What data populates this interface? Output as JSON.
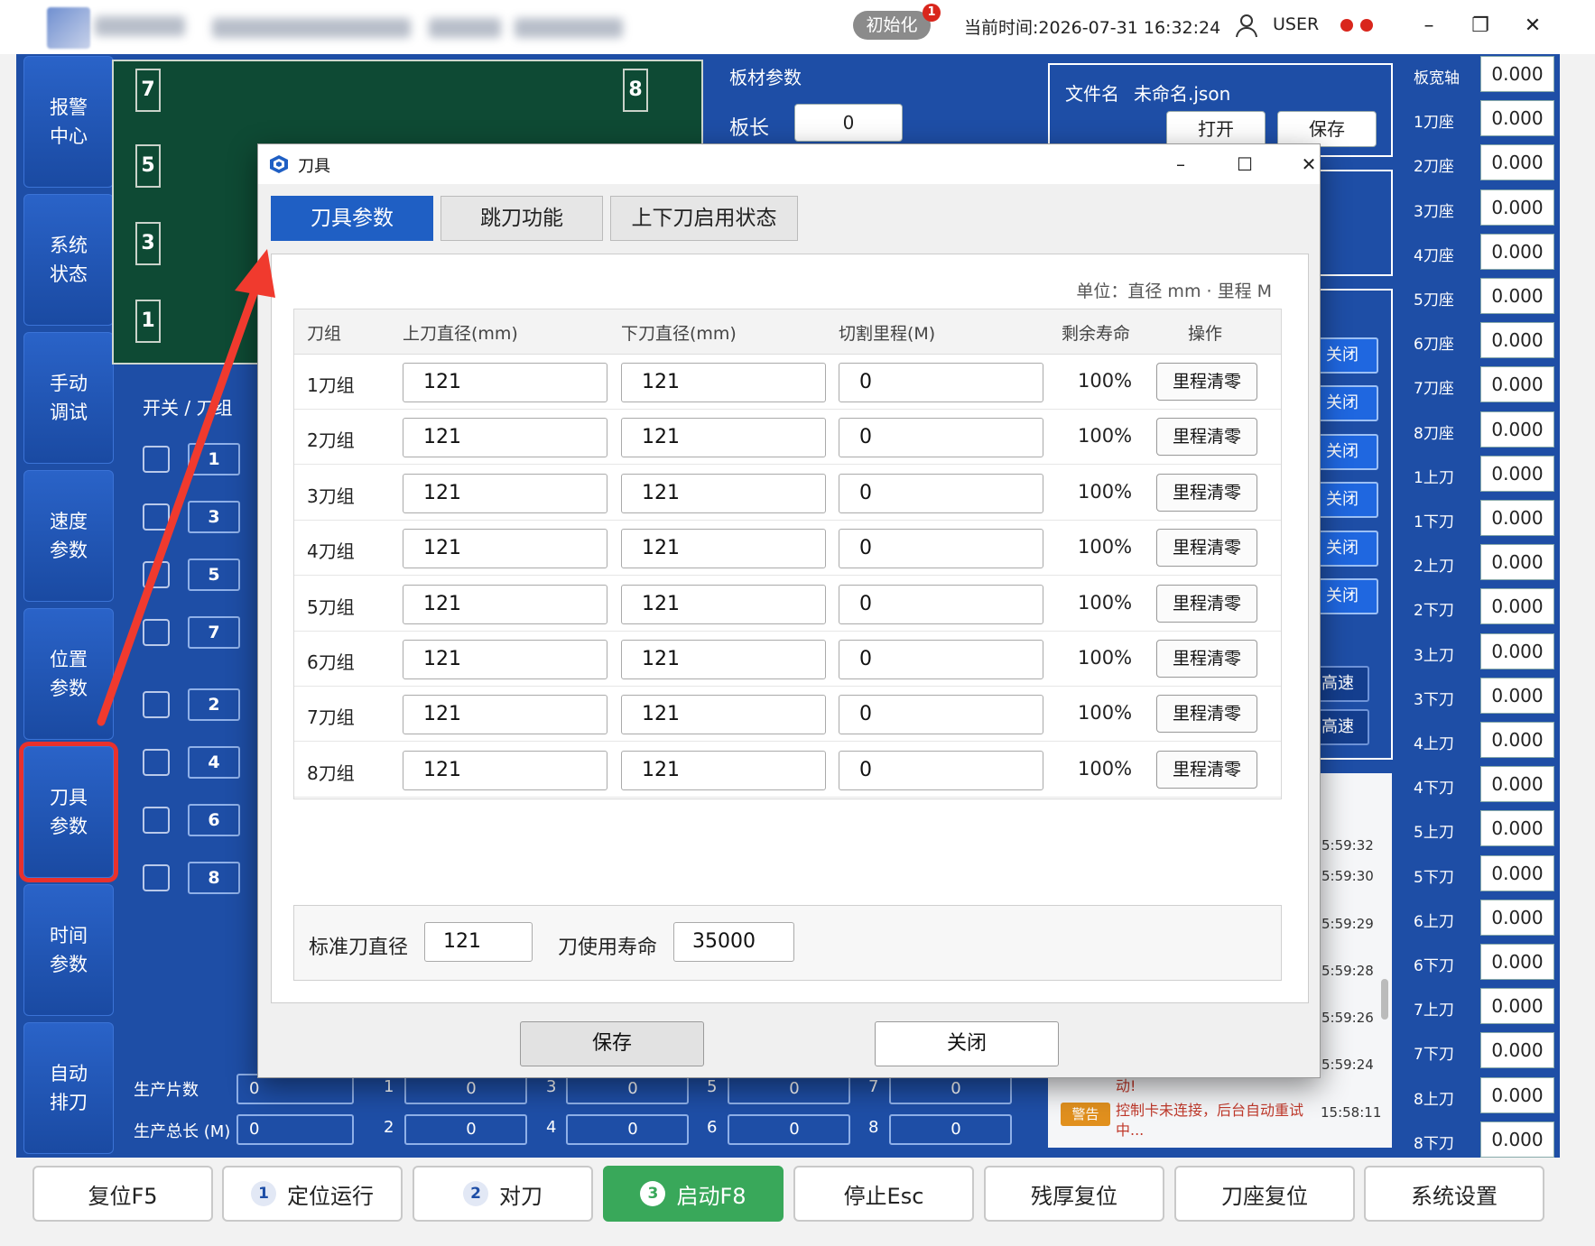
{
  "titlebar": {
    "init_badge": "初始化",
    "notify_count": "1",
    "current_time": "当前时间:2026-07-31 16:32:24",
    "user": "USER",
    "min": "–",
    "max": "❐",
    "close": "✕"
  },
  "nav": [
    {
      "line1": "报警",
      "line2": "中心"
    },
    {
      "line1": "系统",
      "line2": "状态"
    },
    {
      "line1": "手动",
      "line2": "调试"
    },
    {
      "line1": "速度",
      "line2": "参数"
    },
    {
      "line1": "位置",
      "line2": "参数"
    },
    {
      "line1": "刀具",
      "line2": "参数"
    },
    {
      "line1": "时间",
      "line2": "参数"
    },
    {
      "line1": "自动",
      "line2": "排刀"
    }
  ],
  "green_labels": {
    "a": "7",
    "b": "8",
    "c": "5",
    "d": "3",
    "e": "1"
  },
  "switch_label": "开关 / 刀组",
  "knife_nums": [
    "1",
    "3",
    "5",
    "7",
    "2",
    "4",
    "6",
    "8"
  ],
  "board": {
    "title": "板材参数",
    "length_label": "板长",
    "length_value": "0"
  },
  "file": {
    "label": "文件名",
    "name": "未命名.json",
    "open": "打开",
    "save": "保存"
  },
  "close_buttons": [
    "关闭",
    "关闭",
    "关闭",
    "关闭",
    "关闭",
    "关闭"
  ],
  "speed_buttons": [
    "高速",
    "高速"
  ],
  "production": {
    "count_label": "生产片数",
    "total_label": "生产总长 (M)",
    "row1": [
      {
        "n": "",
        "v": "0"
      },
      {
        "n": "1",
        "v": "0"
      },
      {
        "n": "3",
        "v": "0"
      },
      {
        "n": "5",
        "v": "0"
      },
      {
        "n": "7",
        "v": "0"
      }
    ],
    "row2": [
      {
        "n": "",
        "v": "0"
      },
      {
        "n": "2",
        "v": "0"
      },
      {
        "n": "4",
        "v": "0"
      },
      {
        "n": "6",
        "v": "0"
      },
      {
        "n": "8",
        "v": "0"
      }
    ]
  },
  "log": {
    "times": [
      "5:59:32",
      "5:59:30",
      "5:59:29",
      "5:59:28",
      "5:59:26",
      "5:59:24"
    ],
    "partial_text": "动!",
    "entry_tag": "警告",
    "entry_text": "控制卡未连接，后台自动重试中...",
    "entry_time": "15:58:11"
  },
  "axes": [
    {
      "label": "板宽轴",
      "value": "0.000"
    },
    {
      "label": "1刀座",
      "value": "0.000"
    },
    {
      "label": "2刀座",
      "value": "0.000"
    },
    {
      "label": "3刀座",
      "value": "0.000"
    },
    {
      "label": "4刀座",
      "value": "0.000"
    },
    {
      "label": "5刀座",
      "value": "0.000"
    },
    {
      "label": "6刀座",
      "value": "0.000"
    },
    {
      "label": "7刀座",
      "value": "0.000"
    },
    {
      "label": "8刀座",
      "value": "0.000"
    },
    {
      "label": "1上刀",
      "value": "0.000"
    },
    {
      "label": "1下刀",
      "value": "0.000"
    },
    {
      "label": "2上刀",
      "value": "0.000"
    },
    {
      "label": "2下刀",
      "value": "0.000"
    },
    {
      "label": "3上刀",
      "value": "0.000"
    },
    {
      "label": "3下刀",
      "value": "0.000"
    },
    {
      "label": "4上刀",
      "value": "0.000"
    },
    {
      "label": "4下刀",
      "value": "0.000"
    },
    {
      "label": "5上刀",
      "value": "0.000"
    },
    {
      "label": "5下刀",
      "value": "0.000"
    },
    {
      "label": "6上刀",
      "value": "0.000"
    },
    {
      "label": "6下刀",
      "value": "0.000"
    },
    {
      "label": "7上刀",
      "value": "0.000"
    },
    {
      "label": "7下刀",
      "value": "0.000"
    },
    {
      "label": "8上刀",
      "value": "0.000"
    },
    {
      "label": "8下刀",
      "value": "0.000"
    }
  ],
  "bottom": [
    {
      "num": "",
      "label": "复位F5"
    },
    {
      "num": "1",
      "label": "定位运行"
    },
    {
      "num": "2",
      "label": "对刀"
    },
    {
      "num": "3",
      "label": "启动F8"
    },
    {
      "num": "",
      "label": "停止Esc"
    },
    {
      "num": "",
      "label": "残厚复位"
    },
    {
      "num": "",
      "label": "刀座复位"
    },
    {
      "num": "",
      "label": "系统设置"
    }
  ],
  "dialog": {
    "title": "刀具",
    "tabs": [
      "刀具参数",
      "跳刀功能",
      "上下刀启用状态"
    ],
    "unit": "单位：直径 mm · 里程 M",
    "headers": [
      "刀组",
      "上刀直径(mm)",
      "下刀直径(mm)",
      "切割里程(M)",
      "剩余寿命",
      "操作"
    ],
    "rows": [
      {
        "group": "1刀组",
        "upper": "121",
        "lower": "121",
        "mileage": "0",
        "life": "100%",
        "action": "里程清零"
      },
      {
        "group": "2刀组",
        "upper": "121",
        "lower": "121",
        "mileage": "0",
        "life": "100%",
        "action": "里程清零"
      },
      {
        "group": "3刀组",
        "upper": "121",
        "lower": "121",
        "mileage": "0",
        "life": "100%",
        "action": "里程清零"
      },
      {
        "group": "4刀组",
        "upper": "121",
        "lower": "121",
        "mileage": "0",
        "life": "100%",
        "action": "里程清零"
      },
      {
        "group": "5刀组",
        "upper": "121",
        "lower": "121",
        "mileage": "0",
        "life": "100%",
        "action": "里程清零"
      },
      {
        "group": "6刀组",
        "upper": "121",
        "lower": "121",
        "mileage": "0",
        "life": "100%",
        "action": "里程清零"
      },
      {
        "group": "7刀组",
        "upper": "121",
        "lower": "121",
        "mileage": "0",
        "life": "100%",
        "action": "里程清零"
      },
      {
        "group": "8刀组",
        "upper": "121",
        "lower": "121",
        "mileage": "0",
        "life": "100%",
        "action": "里程清零"
      }
    ],
    "std_diameter_label": "标准刀直径",
    "std_diameter_value": "121",
    "life_label": "刀使用寿命",
    "life_value": "35000",
    "save": "保存",
    "close": "关闭"
  },
  "colors": {
    "primary_blue": "#1e4ea6",
    "accent_blue": "#1f5fc4",
    "start_green": "#39a85a",
    "alert_red": "#e8312d"
  }
}
